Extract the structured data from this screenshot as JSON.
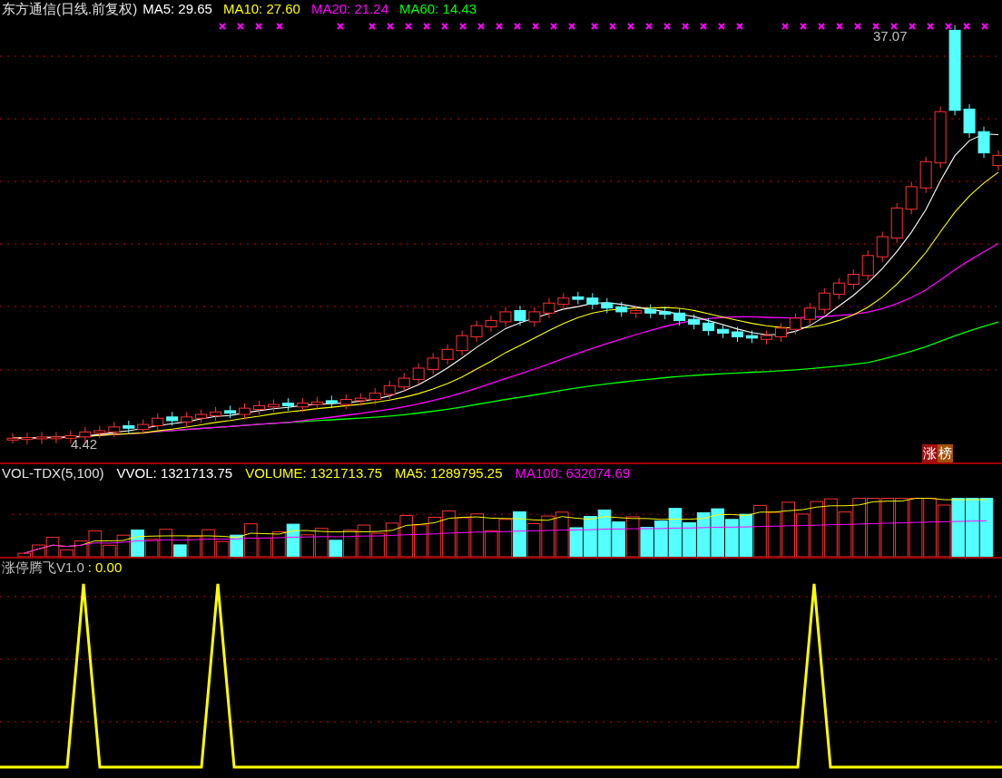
{
  "price_panel": {
    "title": "东方通信(日线.前复权)",
    "legend": [
      {
        "label": "MA5: 29.65",
        "color": "#ffffff"
      },
      {
        "label": "MA10: 27.60",
        "color": "#ffff00"
      },
      {
        "label": "MA20: 21.24",
        "color": "#ff00ff"
      },
      {
        "label": "MA60: 14.43",
        "color": "#00ff00"
      }
    ],
    "high_label": "37.07",
    "low_label": "4.42",
    "badge": [
      "涨",
      "榜"
    ]
  },
  "volume_panel": {
    "title": "VOL-TDX(5,100)",
    "legend": [
      {
        "label": "VVOL: 1321713.75",
        "color": "#ffffff"
      },
      {
        "label": "VOLUME: 1321713.75",
        "color": "#ffff00"
      },
      {
        "label": "MA5: 1289795.25",
        "color": "#ffff00"
      },
      {
        "label": "MA100: 632074.69",
        "color": "#ff00ff"
      }
    ]
  },
  "indicator_panel": {
    "title": "涨停腾飞V1.0",
    "separator": ":",
    "value": "0.00"
  }
}
